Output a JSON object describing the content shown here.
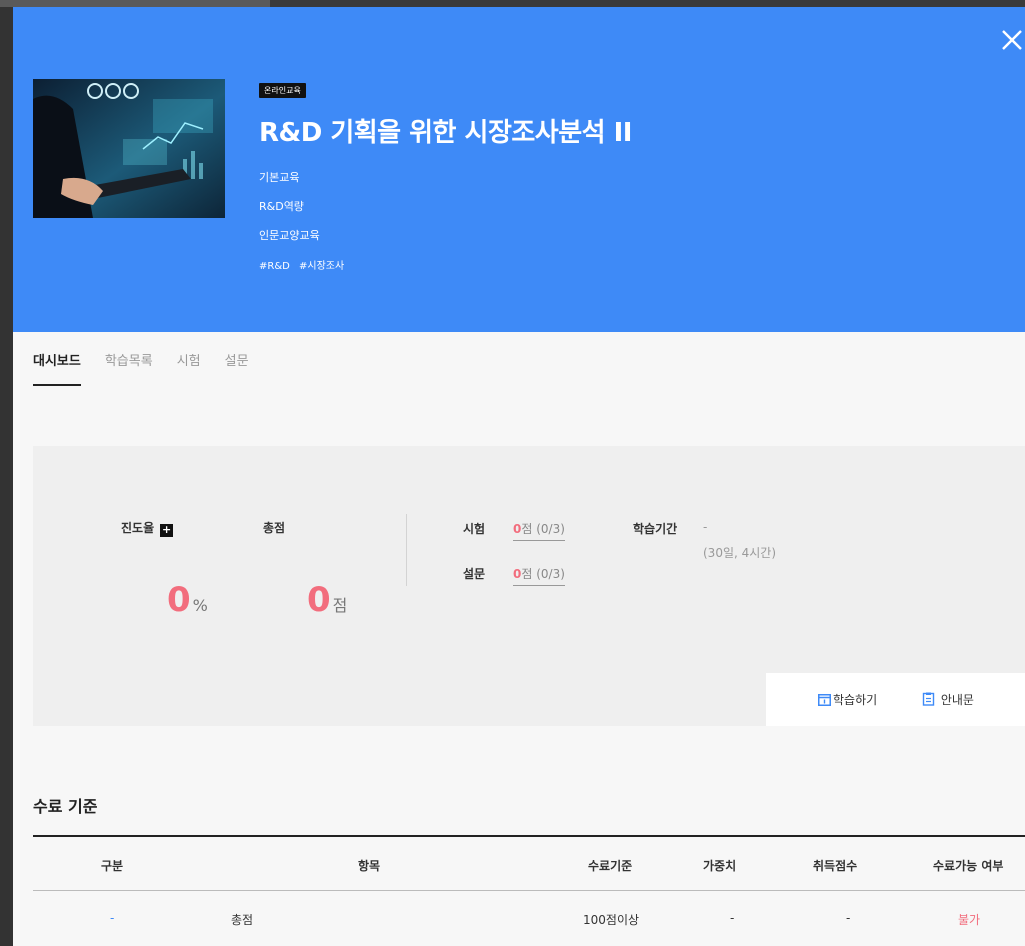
{
  "course": {
    "badge": "온라인교육",
    "title": "R&D 기획을 위한 시장조사분석 II",
    "category1": "기본교육",
    "category2": "R&D역량",
    "category3": "인문교양교육",
    "tags": [
      "#R&D",
      "#시장조사"
    ]
  },
  "tabs": [
    "대시보드",
    "학습목록",
    "시험",
    "설문"
  ],
  "dashboard": {
    "progress_label": "진도율",
    "progress_plus": "+",
    "progress_value": "0",
    "progress_unit": "%",
    "progress_fraction": 0,
    "score_label": "총점",
    "score_value": "0",
    "score_unit": "점",
    "exam_label": "시험",
    "exam_score": "0",
    "exam_rest": "점 (0/3)",
    "survey_label": "설문",
    "survey_score": "0",
    "survey_rest": "점 (0/3)",
    "period_label": "학습기간",
    "period_value": "-",
    "period_detail": "(30일, 4시간)",
    "study_button": "학습하기",
    "guide_button": "안내문"
  },
  "criteria": {
    "title": "수료 기준",
    "headers": [
      "구분",
      "항목",
      "수료기준",
      "가중치",
      "취득점수",
      "수료가능 여부"
    ],
    "rows": [
      [
        "-",
        "총점",
        "100점이상",
        "-",
        "-",
        "불가"
      ]
    ]
  },
  "colors": {
    "hero_bg": "#3e8af7",
    "accent_red": "#f26d7d",
    "accent_blue": "#3e8af7"
  },
  "icons": {
    "close": "close-icon",
    "study": "calendar-icon",
    "guide": "clipboard-icon"
  }
}
